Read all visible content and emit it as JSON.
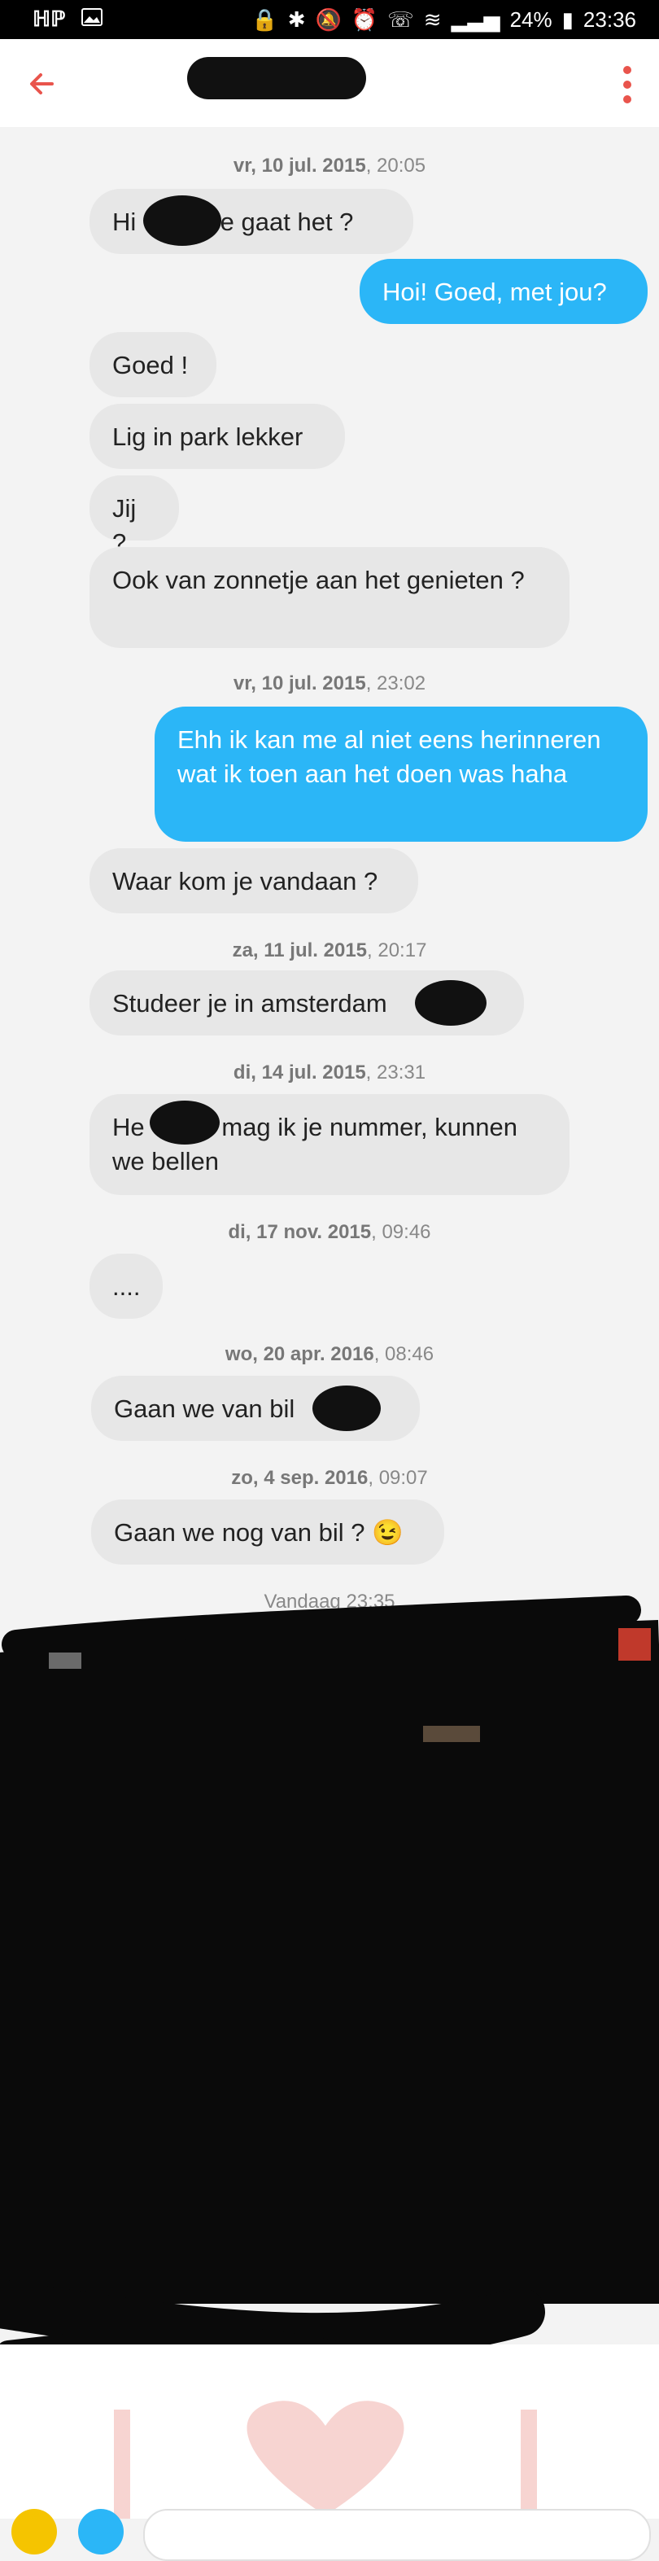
{
  "status": {
    "left_icons": [
      "hp-icon",
      "image-icon"
    ],
    "battery": "24%",
    "time": "23:36"
  },
  "appbar": {
    "back_icon": "arrow-left-icon",
    "menu_icon": "more-vert-icon"
  },
  "colors": {
    "accent": "#e9544c",
    "outgoing": "#2bb6f7",
    "incoming": "#e7e7e7"
  },
  "messages": [
    {
      "date": "vr, 10 jul. 2015",
      "time": "20:05"
    },
    {
      "text": "Hi        hoe gaat het ?"
    },
    {
      "text": "Hoi! Goed, met jou?"
    },
    {
      "text": "Goed !"
    },
    {
      "text": "Lig in park lekker"
    },
    {
      "text": "Jij ?"
    },
    {
      "text": "Ook van zonnetje aan het genieten ?"
    },
    {
      "date": "vr, 10 jul. 2015",
      "time": "23:02"
    },
    {
      "text": "Ehh ik kan me al niet eens herinneren wat ik toen aan het doen was haha"
    },
    {
      "text": "Waar kom je vandaan ?"
    },
    {
      "date": "za, 11 jul. 2015",
      "time": "20:17"
    },
    {
      "text": "Studeer je in amsterdam        ?"
    },
    {
      "date": "di, 14 jul. 2015",
      "time": "23:31"
    },
    {
      "text": "He           mag ik je nummer, kunnen we bellen"
    },
    {
      "date": "di, 17 nov. 2015",
      "time": "09:46"
    },
    {
      "text": "...."
    },
    {
      "date": "wo, 20 apr. 2016",
      "time": "08:46"
    },
    {
      "text": "Gaan we van bil          ?"
    },
    {
      "date": "zo, 4 sep. 2016",
      "time": "09:07"
    },
    {
      "text": "Gaan we nog van bil ? 😉"
    },
    {
      "date": "Vandaag",
      "time": "23:35"
    }
  ]
}
